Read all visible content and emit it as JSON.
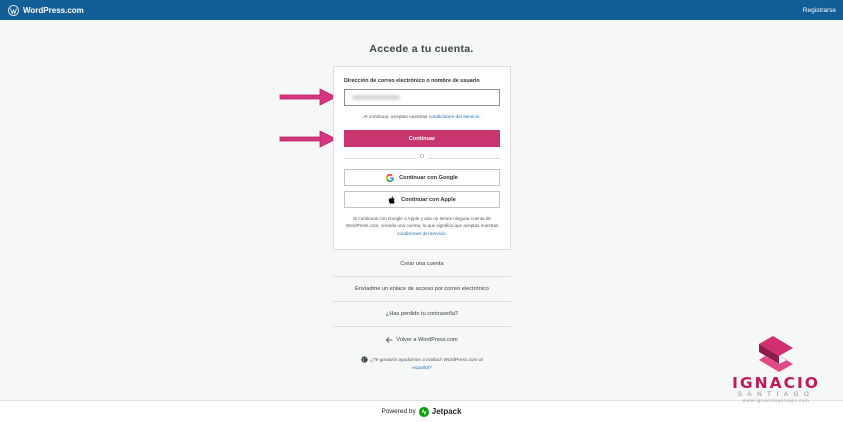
{
  "topbar": {
    "brand": "WordPress.com",
    "register_label": "Registrarse"
  },
  "login": {
    "heading": "Accede a tu cuenta.",
    "email_label": "Dirección de correo electrónico o nombre de usuario",
    "tos_prefix": "Al continuar, aceptas nuestras",
    "tos_link": "condiciones del servicio",
    "tos_suffix": ".",
    "continue_label": "Continuar",
    "or_text": "O",
    "google_label": "Continuar con Google",
    "apple_label": "Continuar con Apple",
    "social_note_prefix": "Si continuas con Google o Apple y aún no tienes ninguna cuenta de WordPress.com, crearás una cuenta, lo que significa que aceptas nuestras",
    "social_note_link": "condiciones del servicio",
    "social_note_suffix": "."
  },
  "footer_links": {
    "create_account": "Crear una cuenta",
    "email_link": "Envíadme un enlace de acceso por correo electrónico",
    "lost_password": "¿Has perdido tu contraseña?",
    "back": "Volver a WordPress.com"
  },
  "translate": {
    "text": "¿Te gustaría ayudarnos a traducir WordPress.com al",
    "link": "español?"
  },
  "bottom": {
    "powered_by": "Powered by",
    "jetpack": "Jetpack"
  },
  "watermark": {
    "name": "IGNACIO",
    "surname": "SANTIAGO",
    "url": "www.ignaciosantiago.com"
  },
  "colors": {
    "topbar": "#135e96",
    "primary_button": "#c9356e",
    "link": "#2271b1",
    "annotation_arrow": "#d6367f",
    "watermark": "#c2195b"
  },
  "icons": {
    "brand": "wordpress-logo-icon",
    "google": "google-icon",
    "apple": "apple-icon",
    "back": "arrow-left-icon",
    "translate": "globe-icon",
    "jetpack": "jetpack-icon"
  }
}
